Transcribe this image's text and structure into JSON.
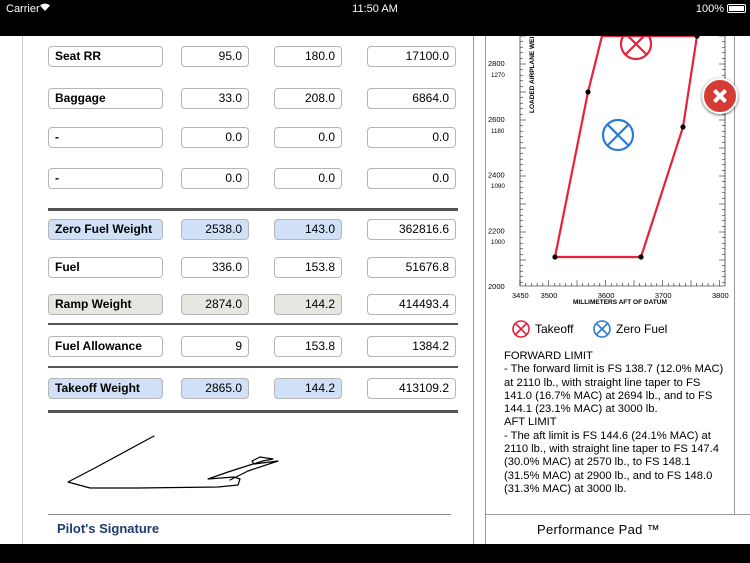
{
  "status_bar": {
    "carrier": "Carrier",
    "time": "11:50 AM",
    "battery": "100%"
  },
  "rows": [
    {
      "label": "Seat RR",
      "weight": "95.0",
      "arm": "180.0",
      "moment": "17100.0"
    },
    {
      "label": "Baggage",
      "weight": "33.0",
      "arm": "208.0",
      "moment": "6864.0"
    },
    {
      "label": "-",
      "weight": "0.0",
      "arm": "0.0",
      "moment": "0.0"
    },
    {
      "label": "-",
      "weight": "0.0",
      "arm": "0.0",
      "moment": "0.0"
    },
    {
      "label": "Zero Fuel Weight",
      "weight": "2538.0",
      "arm": "143.0",
      "moment": "362816.6"
    },
    {
      "label": "Fuel",
      "weight": "336.0",
      "arm": "153.8",
      "moment": "51676.8"
    },
    {
      "label": "Ramp Weight",
      "weight": "2874.0",
      "arm": "144.2",
      "moment": "414493.4"
    },
    {
      "label": "Fuel Allowance",
      "weight": "9",
      "arm": "153.8",
      "moment": "1384.2"
    },
    {
      "label": "Takeoff Weight",
      "weight": "2865.0",
      "arm": "144.2",
      "moment": "413109.2"
    }
  ],
  "signature": {
    "label": "Pilot's Signature"
  },
  "chart_data": {
    "type": "line",
    "xlabel": "MILLIMETERS AFT OF DATUM",
    "ylabel": "LOADED AIRPLANE WEI",
    "x_ticks": [
      "3450",
      "3500",
      "3600",
      "3700",
      "3800"
    ],
    "y_ticks": [
      "2000",
      "2200",
      "2400",
      "2600",
      "2800"
    ],
    "y_ticks_kg": [
      "1000",
      "1090",
      "1180",
      "1270"
    ],
    "envelope_color": "#e8213a",
    "points": [
      {
        "name": "Takeoff",
        "color": "#e8213a",
        "shape": "x-circle"
      },
      {
        "name": "Zero Fuel",
        "color": "#2b7bd6",
        "shape": "x-circle"
      }
    ]
  },
  "legend": {
    "takeoff": "Takeoff",
    "zero_fuel": "Zero Fuel"
  },
  "limits": {
    "forward_title": "FORWARD LIMIT",
    "forward_text": "- The forward limit is FS 138.7 (12.0% MAC) at 2110 lb., with straight line taper to FS 141.0 (16.7% MAC) at 2694 lb., and to FS 144.1 (23.1% MAC) at 3000 lb.",
    "aft_title": "AFT LIMIT",
    "aft_text": " - The aft limit is FS 144.6 (24.1% MAC) at 2110 lb., with straight line taper to FS 147.4 (30.0% MAC) at 2570 lb., to FS 148.1 (31.5% MAC) at 2900 lb., and to FS 148.0 (31.3% MAC) at 3000 lb."
  },
  "brand": "Performance Pad ™"
}
